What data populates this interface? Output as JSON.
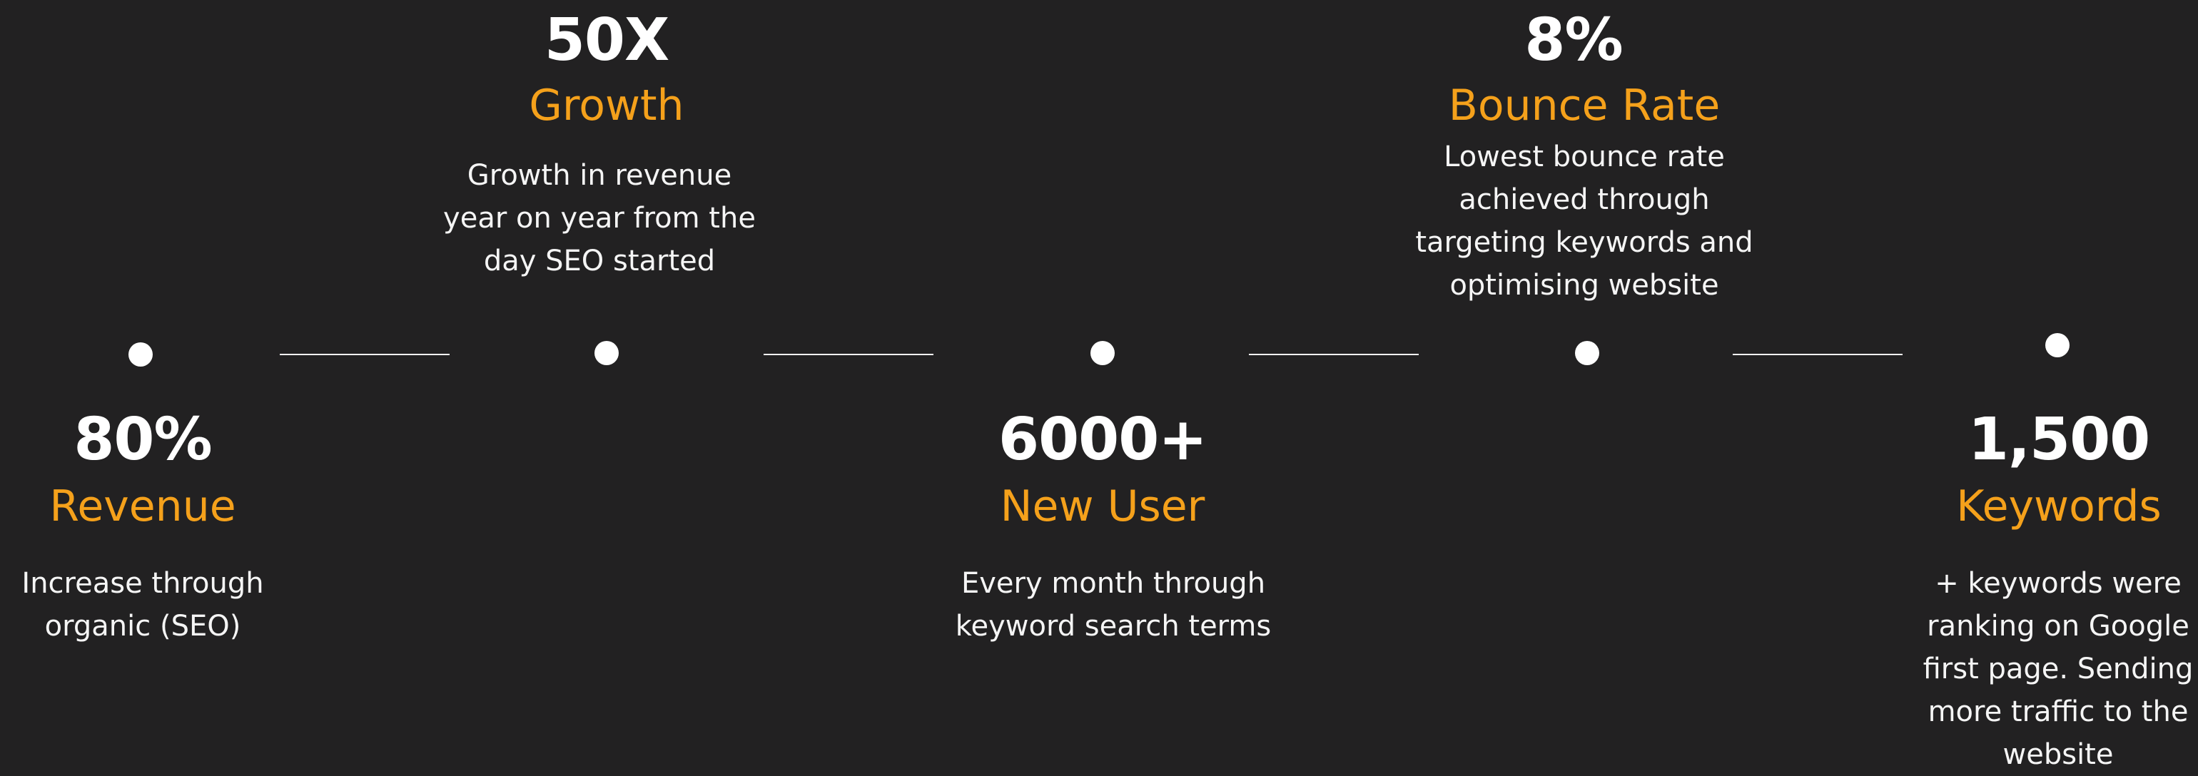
{
  "colors": {
    "background": "#222122",
    "accent": "#f5a11b",
    "text": "#ffffff"
  },
  "timeline": {
    "milestones": [
      {
        "value": "80%",
        "label": "Revenue",
        "description": [
          "Increase through",
          "organic (SEO)"
        ]
      },
      {
        "value": "50X",
        "label": "Growth",
        "description": [
          "Growth in revenue",
          "year on year from the",
          "day SEO started"
        ]
      },
      {
        "value": "6000+",
        "label": "New User",
        "description": [
          "Every month through",
          "keyword search terms"
        ]
      },
      {
        "value": "8%",
        "label": "Bounce Rate",
        "description": [
          "Lowest bounce rate",
          "achieved through",
          "targeting keywords and",
          "optimising website"
        ]
      },
      {
        "value": "1,500",
        "label": "Keywords",
        "description": [
          "+ keywords were",
          "ranking on Google",
          "first page. Sending",
          "more traffic to the",
          "website"
        ]
      }
    ]
  }
}
